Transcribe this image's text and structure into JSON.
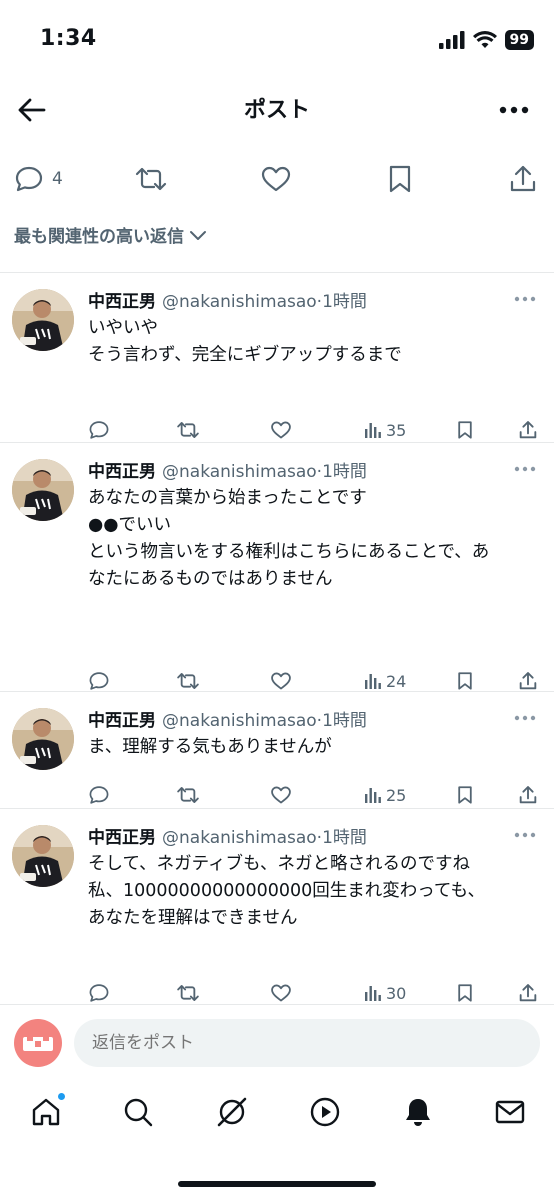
{
  "status": {
    "time": "1:34",
    "battery": "99"
  },
  "header": {
    "title": "ポスト"
  },
  "action_bar": {
    "reply_count": "4"
  },
  "sort": {
    "label": "最も関連性の高い返信"
  },
  "replies": [
    {
      "name": "中西正男",
      "handle": "@nakanishimasao",
      "time": "1時間",
      "lines": [
        "いやいや",
        "",
        "そう言わず、完全にギブアップするまで"
      ],
      "views": "35"
    },
    {
      "name": "中西正男",
      "handle": "@nakanishimasao",
      "time": "1時間",
      "lines": [
        "あなたの言葉から始まったことです",
        "",
        "●●でいい",
        "",
        "という物言いをする権利はこちらにあることで、あ",
        "なたにあるものではありません"
      ],
      "views": "24"
    },
    {
      "name": "中西正男",
      "handle": "@nakanishimasao",
      "time": "1時間",
      "lines": [
        "ま、理解する気もありませんが"
      ],
      "views": "25"
    },
    {
      "name": "中西正男",
      "handle": "@nakanishimasao",
      "time": "1時間",
      "lines": [
        "そして、ネガティブも、ネガと略されるのですね",
        "",
        "私、10000000000000000回生まれ変わっても、",
        "あなたを理解はできません"
      ],
      "views": "30"
    }
  ],
  "compose": {
    "placeholder": "返信をポスト"
  },
  "tabs": [
    "home",
    "search",
    "grok",
    "video",
    "notifications",
    "messages"
  ]
}
